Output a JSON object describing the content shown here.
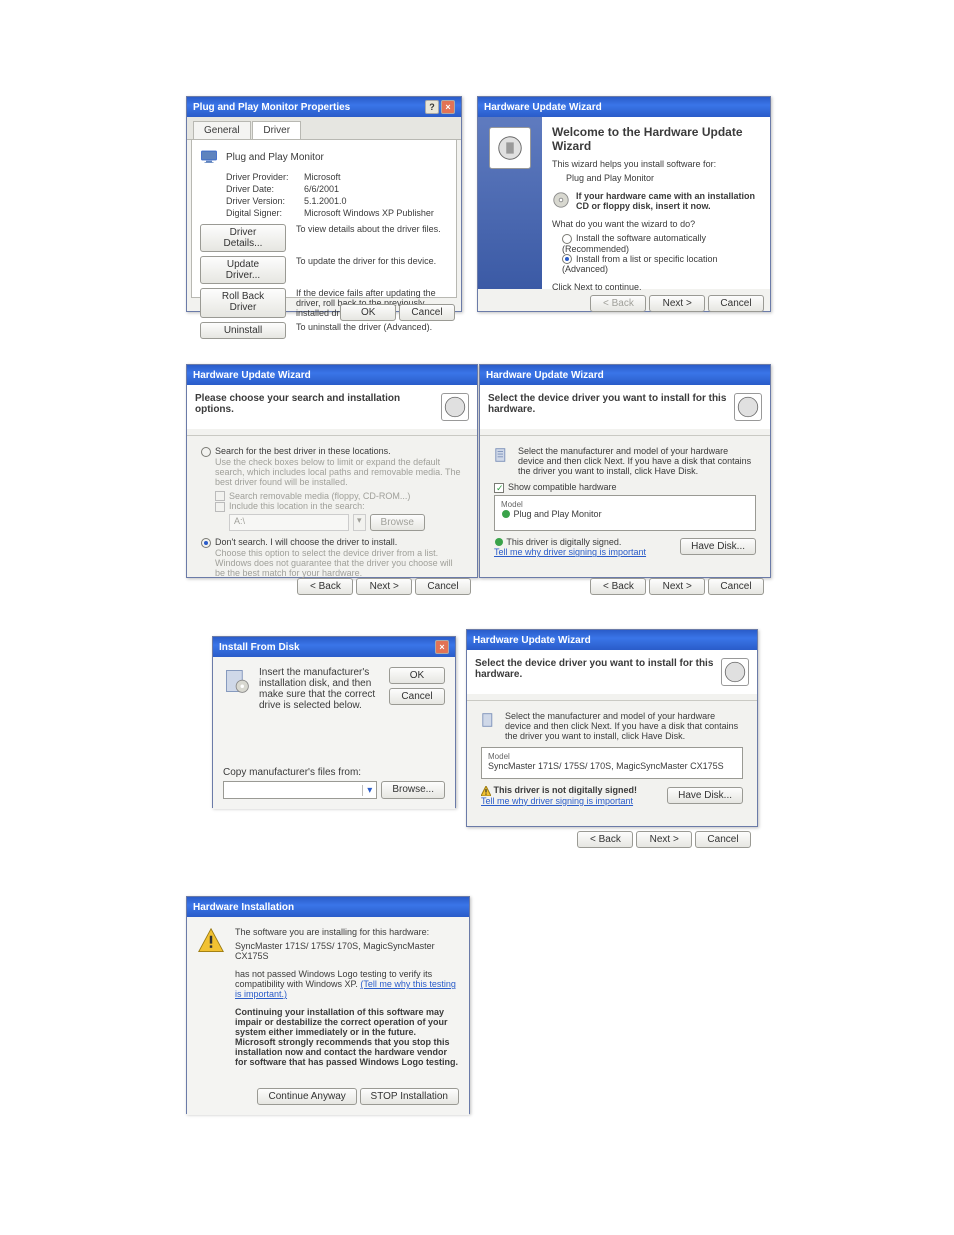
{
  "colors": {
    "accent": "#2a5cc9"
  },
  "prop": {
    "title": "Plug and Play Monitor Properties",
    "tabs": {
      "general": "General",
      "driver": "Driver"
    },
    "heading": "Plug and Play Monitor",
    "rows": {
      "provider_lbl": "Driver Provider:",
      "provider_val": "Microsoft",
      "date_lbl": "Driver Date:",
      "date_val": "6/6/2001",
      "version_lbl": "Driver Version:",
      "version_val": "5.1.2001.0",
      "signer_lbl": "Digital Signer:",
      "signer_val": "Microsoft Windows XP Publisher"
    },
    "buttons": {
      "details": "Driver Details...",
      "details_desc": "To view details about the driver files.",
      "update": "Update Driver...",
      "update_desc": "To update the driver for this device.",
      "rollback": "Roll Back Driver",
      "rollback_desc": "If the device fails after updating the driver, roll back to the previously installed driver.",
      "uninstall": "Uninstall",
      "uninstall_desc": "To uninstall the driver (Advanced)."
    },
    "ok": "OK",
    "cancel": "Cancel"
  },
  "wiz1": {
    "title": "Hardware Update Wizard",
    "welcome": "Welcome to the Hardware Update Wizard",
    "intro": "This wizard helps you install software for:",
    "device": "Plug and Play Monitor",
    "cd_note": "If your hardware came with an installation CD or floppy disk, insert it now.",
    "question": "What do you want the wizard to do?",
    "opt1": "Install the software automatically (Recommended)",
    "opt2": "Install from a list or specific location (Advanced)",
    "cont": "Click Next to continue.",
    "back": "< Back",
    "next": "Next >",
    "cancel": "Cancel"
  },
  "wiz2": {
    "title": "Hardware Update Wizard",
    "header": "Please choose your search and installation options.",
    "opt1": "Search for the best driver in these locations.",
    "opt1_desc": "Use the check boxes below to limit or expand the default search, which includes local paths and removable media. The best driver found will be installed.",
    "chk1": "Search removable media (floppy, CD-ROM...)",
    "chk2": "Include this location in the search:",
    "path": "A:\\",
    "browse": "Browse",
    "opt2": "Don't search. I will choose the driver to install.",
    "opt2_desc": "Choose this option to select the device driver from a list. Windows does not guarantee that the driver you choose will be the best match for your hardware.",
    "back": "< Back",
    "next": "Next >",
    "cancel": "Cancel"
  },
  "wiz3": {
    "title": "Hardware Update Wizard",
    "header": "Select the device driver you want to install for this hardware.",
    "instr": "Select the manufacturer and model of your hardware device and then click Next. If you have a disk that contains the driver you want to install, click Have Disk.",
    "show_compat": "Show compatible hardware",
    "model_lbl": "Model",
    "model_item": "Plug and Play Monitor",
    "signed": "This driver is digitally signed.",
    "tell": "Tell me why driver signing is important",
    "havedisk": "Have Disk...",
    "back": "< Back",
    "next": "Next >",
    "cancel": "Cancel"
  },
  "ifd": {
    "title": "Install From Disk",
    "msg": "Insert the manufacturer's installation disk, and then make sure that the correct drive is selected below.",
    "ok": "OK",
    "cancel": "Cancel",
    "copy": "Copy manufacturer's files from:",
    "browse": "Browse..."
  },
  "wiz4": {
    "title": "Hardware Update Wizard",
    "header": "Select the device driver you want to install for this hardware.",
    "instr": "Select the manufacturer and model of your hardware device and then click Next. If you have a disk that contains the driver you want to install, click Have Disk.",
    "model_lbl": "Model",
    "model_item": "SyncMaster 171S/ 175S/ 170S, MagicSyncMaster CX175S",
    "unsigned": "This driver is not digitally signed!",
    "tell": "Tell me why driver signing is important",
    "havedisk": "Have Disk...",
    "back": "< Back",
    "next": "Next >",
    "cancel": "Cancel"
  },
  "hi": {
    "title": "Hardware Installation",
    "l1": "The software you are installing for this hardware:",
    "dev": "SyncMaster 171S/ 175S/ 170S, MagicSyncMaster CX175S",
    "l2a": "has not passed Windows Logo testing to verify its compatibility with Windows XP. ",
    "l2_link": "(Tell me why this testing is important.)",
    "l3": "Continuing your installation of this software may impair or destabilize the correct operation of your system either immediately or in the future. Microsoft strongly recommends that you stop this installation now and contact the hardware vendor for software that has passed Windows Logo testing.",
    "cont": "Continue Anyway",
    "stop": "STOP Installation"
  }
}
